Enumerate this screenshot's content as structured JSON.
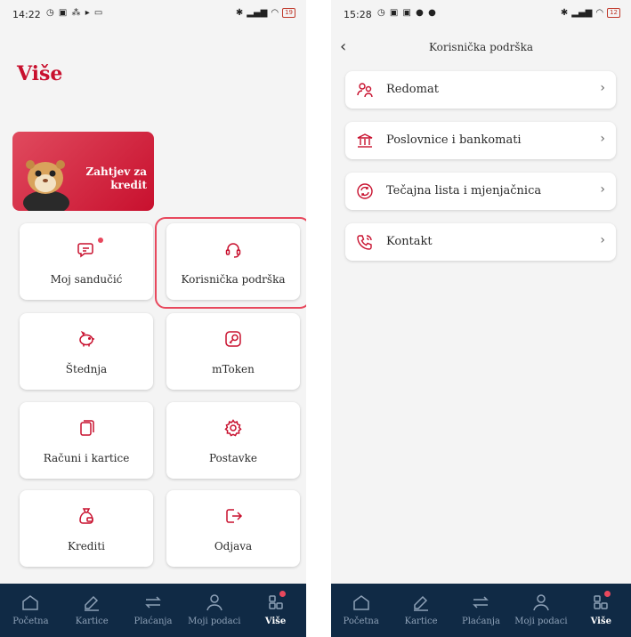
{
  "colors": {
    "accent": "#c8102e",
    "highlight": "#e8485d",
    "navbar": "#102a45"
  },
  "left": {
    "status": {
      "time": "14:22",
      "battery": "19"
    },
    "page_title": "Više",
    "promo": {
      "text": "Zahtjev za\nkredit"
    },
    "tiles": [
      {
        "label": "Moj sandučić",
        "icon": "message-icon"
      },
      {
        "label": "Korisnička podrška",
        "icon": "headset-icon"
      },
      {
        "label": "Štednja",
        "icon": "piggy-bank-icon"
      },
      {
        "label": "mToken",
        "icon": "token-key-icon"
      },
      {
        "label": "Računi i kartice",
        "icon": "cards-icon"
      },
      {
        "label": "Postavke",
        "icon": "gear-icon"
      },
      {
        "label": "Krediti",
        "icon": "money-bag-icon"
      },
      {
        "label": "Odjava",
        "icon": "logout-icon"
      }
    ]
  },
  "right": {
    "status": {
      "time": "15:28",
      "battery": "12"
    },
    "header_title": "Korisnička podrška",
    "rows": [
      {
        "label": "Redomat",
        "icon": "people-icon"
      },
      {
        "label": "Poslovnice i bankomati",
        "icon": "bank-icon"
      },
      {
        "label": "Tečajna lista i mjenjačnica",
        "icon": "exchange-icon"
      },
      {
        "label": "Kontakt",
        "icon": "phone-icon"
      }
    ]
  },
  "nav": [
    {
      "label": "Početna",
      "icon": "home-icon"
    },
    {
      "label": "Kartice",
      "icon": "card-icon"
    },
    {
      "label": "Plaćanja",
      "icon": "transfer-arrows-icon"
    },
    {
      "label": "Moji podaci",
      "icon": "user-icon"
    },
    {
      "label": "Više",
      "icon": "grid-icon",
      "active": true
    }
  ]
}
